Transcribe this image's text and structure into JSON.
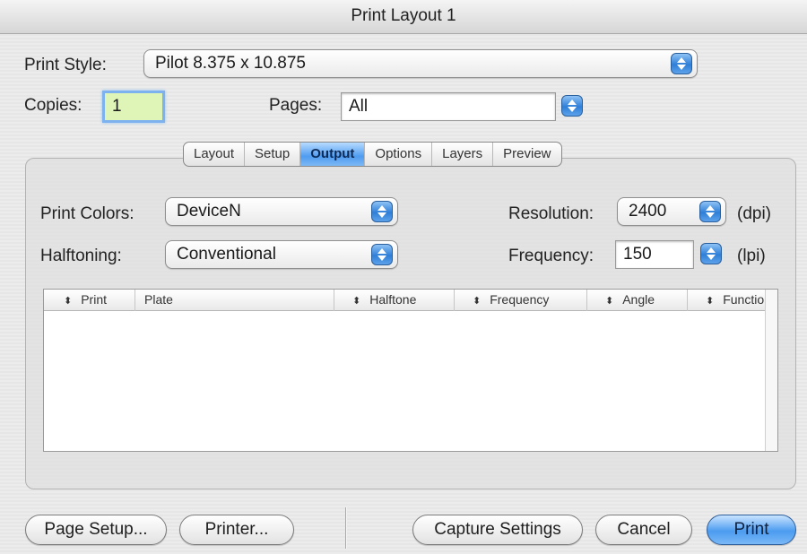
{
  "window": {
    "title": "Print Layout 1"
  },
  "print_style": {
    "label": "Print Style:",
    "value": "Pilot 8.375 x 10.875"
  },
  "copies": {
    "label": "Copies:",
    "value": "1"
  },
  "pages": {
    "label": "Pages:",
    "value": "All"
  },
  "tabs": [
    {
      "label": "Layout",
      "active": false
    },
    {
      "label": "Setup",
      "active": false
    },
    {
      "label": "Output",
      "active": true
    },
    {
      "label": "Options",
      "active": false
    },
    {
      "label": "Layers",
      "active": false
    },
    {
      "label": "Preview",
      "active": false
    }
  ],
  "output": {
    "print_colors": {
      "label": "Print Colors:",
      "value": "DeviceN"
    },
    "halftoning": {
      "label": "Halftoning:",
      "value": "Conventional"
    },
    "resolution": {
      "label": "Resolution:",
      "value": "2400",
      "unit": "(dpi)"
    },
    "frequency": {
      "label": "Frequency:",
      "value": "150",
      "unit": "(lpi)"
    }
  },
  "plate_table": {
    "columns": [
      "Print",
      "Plate",
      "Halftone",
      "Frequency",
      "Angle",
      "Function"
    ],
    "rows": []
  },
  "buttons": {
    "page_setup": "Page Setup...",
    "printer": "Printer...",
    "capture_settings": "Capture Settings",
    "cancel": "Cancel",
    "print": "Print"
  },
  "colors": {
    "accent": "#4b9bf0",
    "copies_field_bg": "#dff5b8"
  },
  "icons": {
    "stepper": "up-down-arrows-icon",
    "sort": "sort-arrows-icon"
  }
}
